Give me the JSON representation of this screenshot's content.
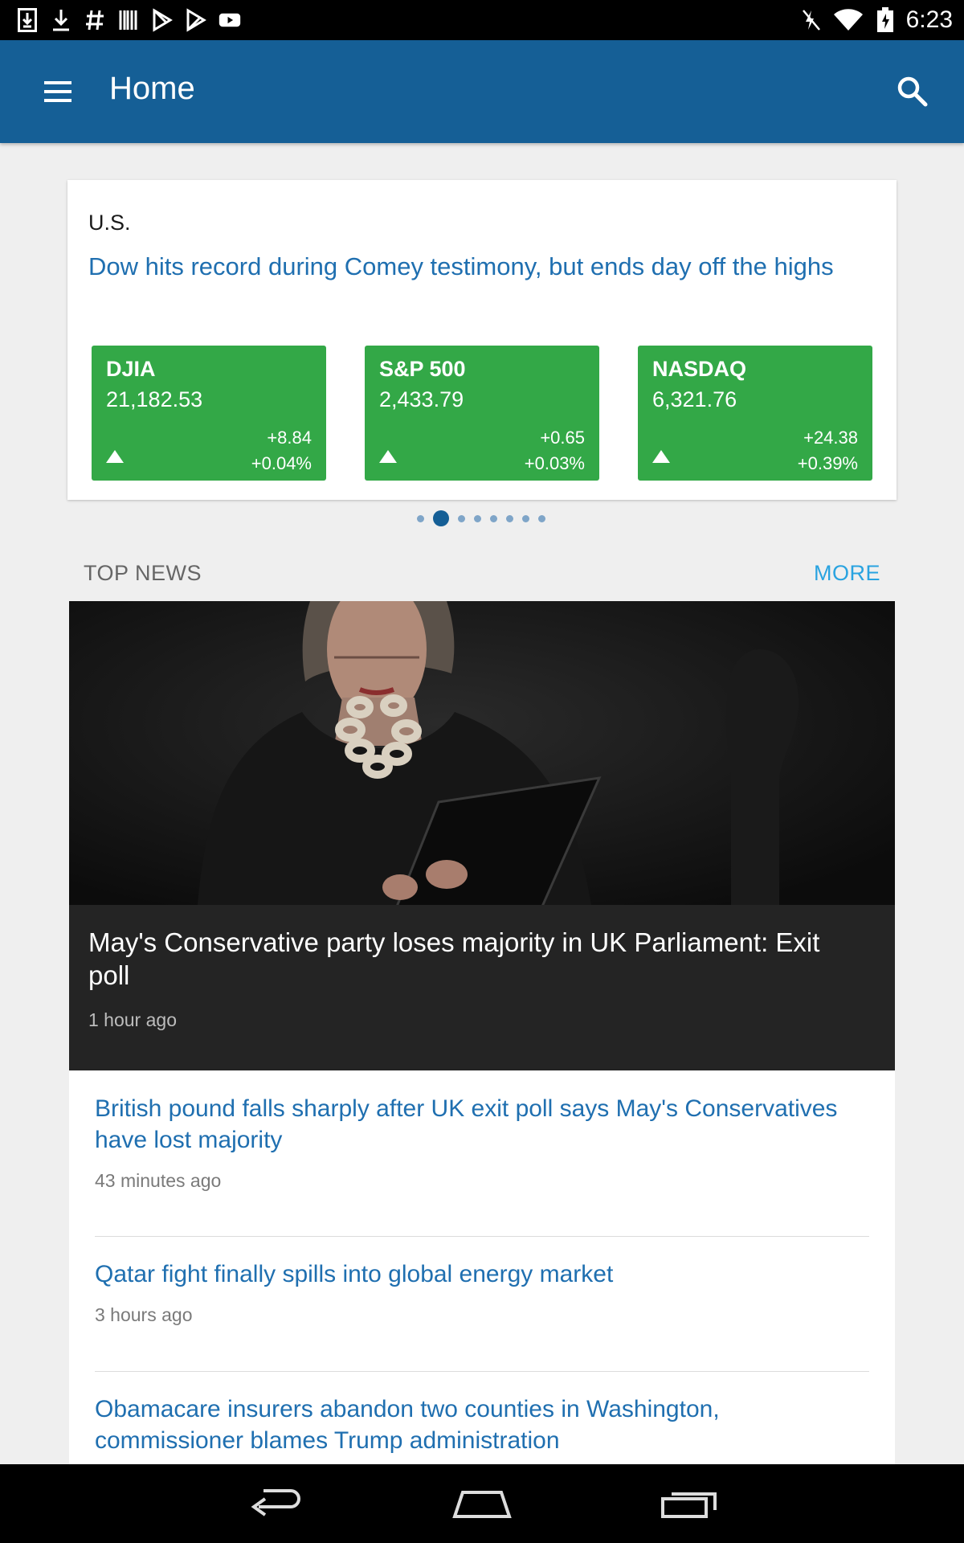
{
  "status_bar": {
    "left_icons": [
      "download-box-icon",
      "download-icon",
      "hash-icon",
      "barcode-icon",
      "play-store-icon",
      "play-store-outline-icon",
      "youtube-icon"
    ],
    "right_icons": [
      "mute-icon",
      "wifi-icon",
      "battery-charging-icon"
    ],
    "time": "6:23"
  },
  "app_bar": {
    "title": "Home",
    "menu_icon": "hamburger-menu-icon",
    "search_icon": "search-icon",
    "color": "#155f96"
  },
  "market": {
    "region": "U.S.",
    "headline": "Dow hits record during Comey testimony, but ends day off the highs",
    "tile_color": "#33a847",
    "indices": [
      {
        "name": "DJIA",
        "value": "21,182.53",
        "change": "+8.84",
        "percent": "+0.04%",
        "direction": "up"
      },
      {
        "name": "S&P 500",
        "value": "2,433.79",
        "change": "+0.65",
        "percent": "+0.03%",
        "direction": "up"
      },
      {
        "name": "NASDAQ",
        "value": "6,321.76",
        "change": "+24.38",
        "percent": "+0.39%",
        "direction": "up"
      }
    ],
    "carousel": {
      "count": 8,
      "active": 1
    }
  },
  "top_news": {
    "section_title": "TOP NEWS",
    "more_label": "MORE",
    "hero": {
      "title": "May's Conservative party loses majority in UK Parliament: Exit poll",
      "time": "1 hour ago"
    },
    "items": [
      {
        "title": "British pound falls sharply after UK exit poll says May's Conservatives have lost majority",
        "time": "43 minutes ago"
      },
      {
        "title": "Qatar fight finally spills into global energy market",
        "time": "3 hours ago"
      },
      {
        "title": "Obamacare insurers abandon two counties in Washington, commissioner blames Trump administration",
        "time": ""
      }
    ]
  },
  "nav_bar": {
    "back_icon": "back-icon",
    "home_icon": "home-icon",
    "recents_icon": "recents-icon"
  }
}
